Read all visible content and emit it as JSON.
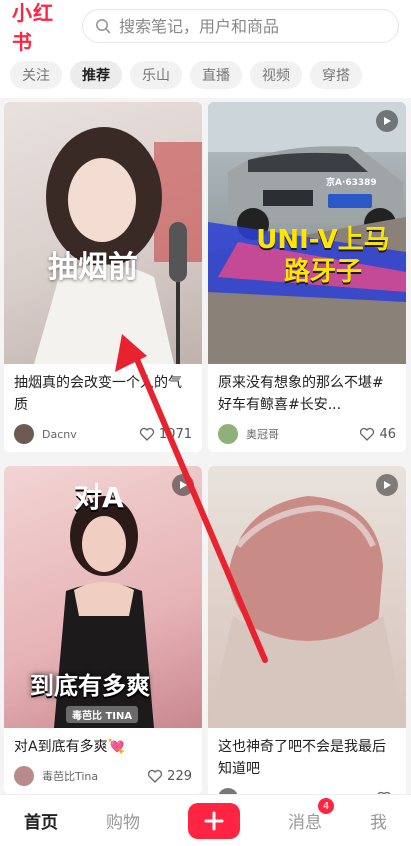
{
  "header": {
    "logo": "小红书",
    "search_placeholder": "搜索笔记，用户和商品"
  },
  "tabs": [
    {
      "label": "关注"
    },
    {
      "label": "推荐",
      "active": true
    },
    {
      "label": "乐山"
    },
    {
      "label": "直播"
    },
    {
      "label": "视频"
    },
    {
      "label": "穿搭"
    }
  ],
  "cards": [
    {
      "overlay": "抽烟前",
      "title": "抽烟真的会改变一个人的气质",
      "author": "Dacnv",
      "likes": "1071",
      "has_play": false
    },
    {
      "overlay": "UNI-V上马路牙子",
      "plate": "京A·63389",
      "title": "原来没有想象的那么不堪#好车有鲸喜#长安...",
      "author": "奥冠哥",
      "likes": "46",
      "has_play": true
    },
    {
      "overlay_top": "对A",
      "overlay_bottom": "到底有多爽",
      "watermark": "毒芭比 TINA",
      "title": "对A到底有多爽💘",
      "author": "毒芭比Tina",
      "likes": "229",
      "has_play": true
    },
    {
      "title": "这也神奇了吧不会是我最后知道吧",
      "author": "",
      "likes": "",
      "has_play": true
    }
  ],
  "bottom_nav": {
    "home": "首页",
    "shop": "购物",
    "post": "+",
    "messages": "消息",
    "messages_badge": "4",
    "me": "我"
  },
  "colors": {
    "brand": "#ff2442",
    "arrow": "#e8222f"
  }
}
